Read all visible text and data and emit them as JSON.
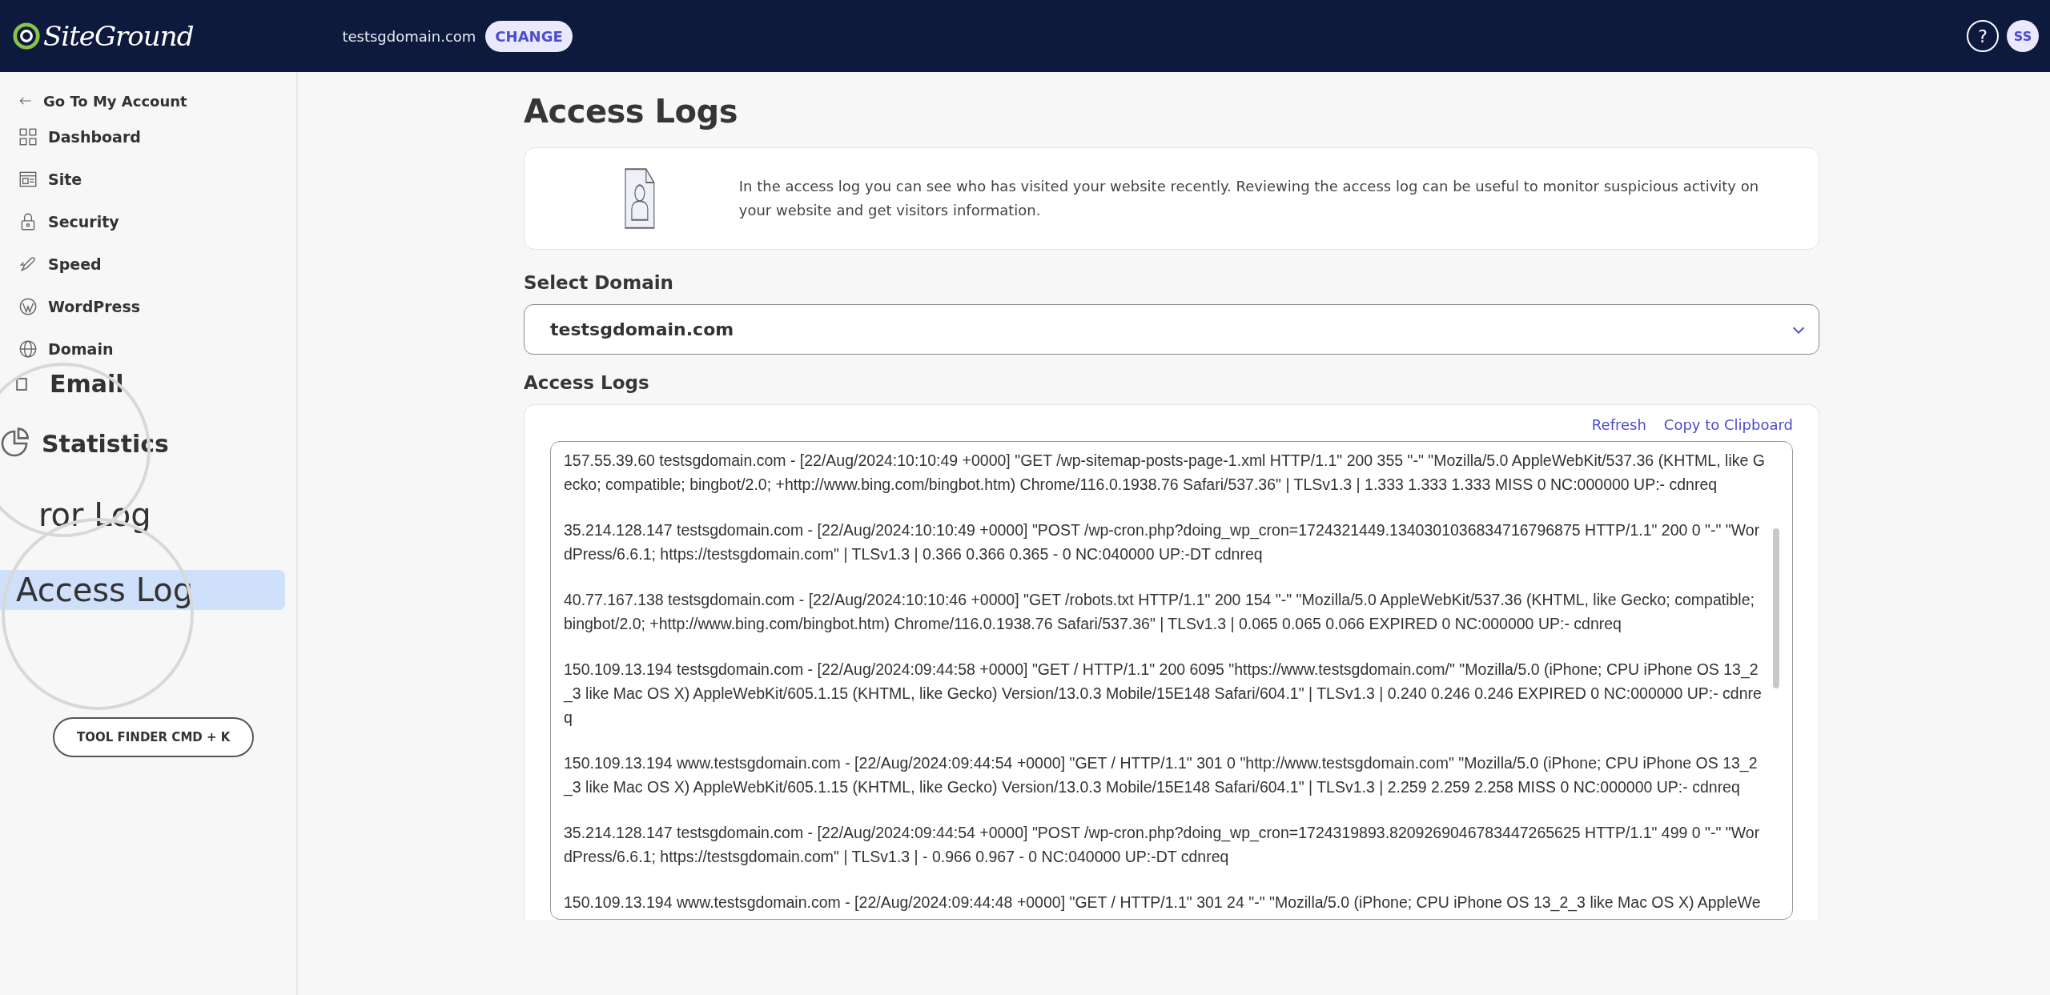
{
  "topbar": {
    "logo": "SiteGround",
    "domain": "testsgdomain.com",
    "change_button": "CHANGE",
    "help": "?",
    "avatar": "SS"
  },
  "sidebar": {
    "back_link": "Go To My Account",
    "items": [
      {
        "label": "Dashboard",
        "selected": false
      },
      {
        "label": "Site",
        "selected": false
      },
      {
        "label": "Security",
        "selected": false
      },
      {
        "label": "Speed",
        "selected": false
      },
      {
        "label": "WordPress",
        "selected": false
      },
      {
        "label": "Domain",
        "selected": false
      }
    ],
    "magnified_items": [
      {
        "label": "Email",
        "selected": false
      },
      {
        "label": "Statistics",
        "selected": false
      },
      {
        "label": "ror Log",
        "selected": false
      },
      {
        "label": "Access Log",
        "selected": true
      }
    ],
    "tool_finder": "TOOL FINDER CMD + K"
  },
  "main": {
    "title": "Access Logs",
    "info": "In the access log you can see who has visited your website recently. Reviewing the access log can be useful to monitor suspicious activity on your website and get visitors information.",
    "select_label": "Select Domain",
    "select_value": "testsgdomain.com",
    "logs_heading": "Access Logs",
    "actions": [
      "Refresh",
      "Copy to Clipboard"
    ],
    "log_entries": [
      "157.55.39.60 testsgdomain.com - [22/Aug/2024:10:10:49 +0000] \"GET /wp-sitemap-posts-page-1.xml HTTP/1.1\" 200 355 \"-\" \"Mozilla/5.0 AppleWebKit/537.36 (KHTML, like Gecko; compatible; bingbot/2.0; +http://www.bing.com/bingbot.htm) Chrome/116.0.1938.76 Safari/537.36\" | TLSv1.3 | 1.333 1.333 1.333 MISS 0 NC:000000 UP:- cdnreq",
      "35.214.128.147 testsgdomain.com - [22/Aug/2024:10:10:49 +0000] \"POST /wp-cron.php?doing_wp_cron=1724321449.1340301036834716796875 HTTP/1.1\" 200 0 \"-\" \"WordPress/6.6.1; https://testsgdomain.com\" | TLSv1.3 | 0.366 0.366 0.365 - 0 NC:040000 UP:-DT cdnreq",
      "40.77.167.138 testsgdomain.com - [22/Aug/2024:10:10:46 +0000] \"GET /robots.txt HTTP/1.1\" 200 154 \"-\" \"Mozilla/5.0 AppleWebKit/537.36 (KHTML, like Gecko; compatible; bingbot/2.0; +http://www.bing.com/bingbot.htm) Chrome/116.0.1938.76 Safari/537.36\" | TLSv1.3 | 0.065 0.065 0.066 EXPIRED 0 NC:000000 UP:- cdnreq",
      "150.109.13.194 testsgdomain.com - [22/Aug/2024:09:44:58 +0000] \"GET / HTTP/1.1\" 200 6095 \"https://www.testsgdomain.com/\" \"Mozilla/5.0 (iPhone; CPU iPhone OS 13_2_3 like Mac OS X) AppleWebKit/605.1.15 (KHTML, like Gecko) Version/13.0.3 Mobile/15E148 Safari/604.1\" | TLSv1.3 | 0.240 0.246 0.246 EXPIRED 0 NC:000000 UP:- cdnreq",
      "150.109.13.194 www.testsgdomain.com - [22/Aug/2024:09:44:54 +0000] \"GET / HTTP/1.1\" 301 0 \"http://www.testsgdomain.com\" \"Mozilla/5.0 (iPhone; CPU iPhone OS 13_2_3 like Mac OS X) AppleWebKit/605.1.15 (KHTML, like Gecko) Version/13.0.3 Mobile/15E148 Safari/604.1\" | TLSv1.3 | 2.259 2.259 2.258 MISS 0 NC:000000 UP:- cdnreq",
      "35.214.128.147 testsgdomain.com - [22/Aug/2024:09:44:54 +0000] \"POST /wp-cron.php?doing_wp_cron=1724319893.8209269046783447265625 HTTP/1.1\" 499 0 \"-\" \"WordPress/6.6.1; https://testsgdomain.com\" | TLSv1.3 | - 0.966 0.967 - 0 NC:040000 UP:-DT cdnreq",
      "150.109.13.194 www.testsgdomain.com - [22/Aug/2024:09:44:48 +0000] \"GET / HTTP/1.1\" 301 24 \"-\" \"Mozilla/5.0 (iPhone; CPU iPhone OS 13_2_3 like Mac OS X) AppleWe"
    ]
  }
}
